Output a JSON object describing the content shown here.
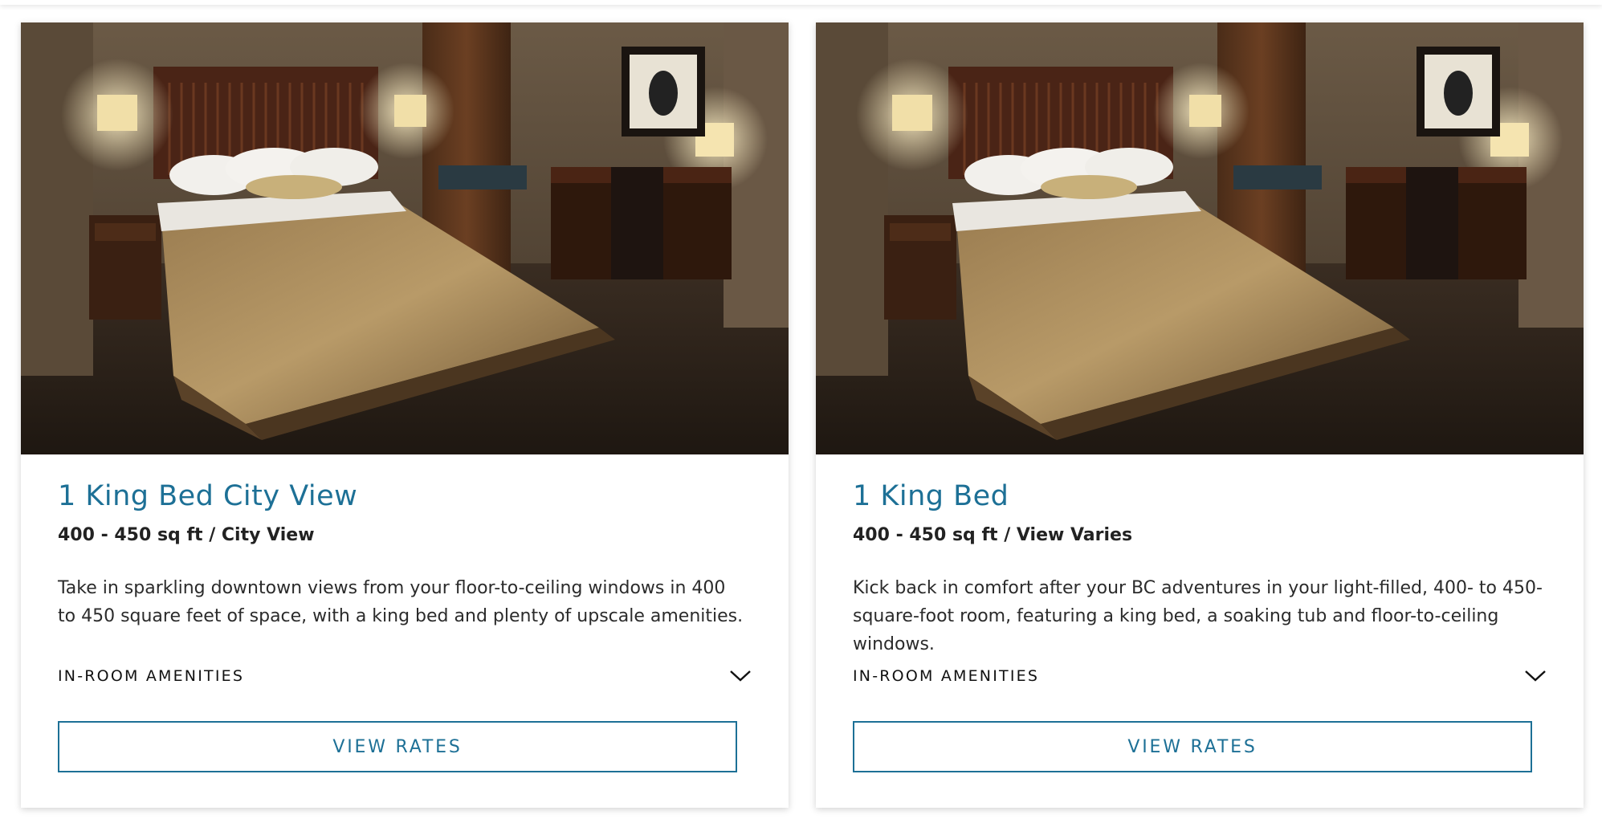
{
  "rooms": [
    {
      "title": "1 King Bed City View",
      "meta": "400 - 450 sq ft / City View",
      "description": "Take in sparkling downtown views from your floor-to-ceiling windows in 400 to 450 square feet of space, with a king bed and plenty of upscale amenities.",
      "amenities_label": "IN-ROOM AMENITIES",
      "amenities_icon": "chevron-down-icon",
      "button_label": "VIEW RATES"
    },
    {
      "title": "1 King Bed",
      "meta": "400 - 450 sq ft / View Varies",
      "description": "Kick back in comfort after your BC adventures in your light-filled, 400- to 450-square-foot room, featuring a king bed, a soaking tub and floor-to-ceiling windows.",
      "amenities_label": "IN-ROOM AMENITIES",
      "amenities_icon": "chevron-down-icon",
      "button_label": "VIEW RATES"
    }
  ],
  "colors": {
    "accent": "#1d7096",
    "text": "#222222",
    "card_background": "#ffffff"
  }
}
